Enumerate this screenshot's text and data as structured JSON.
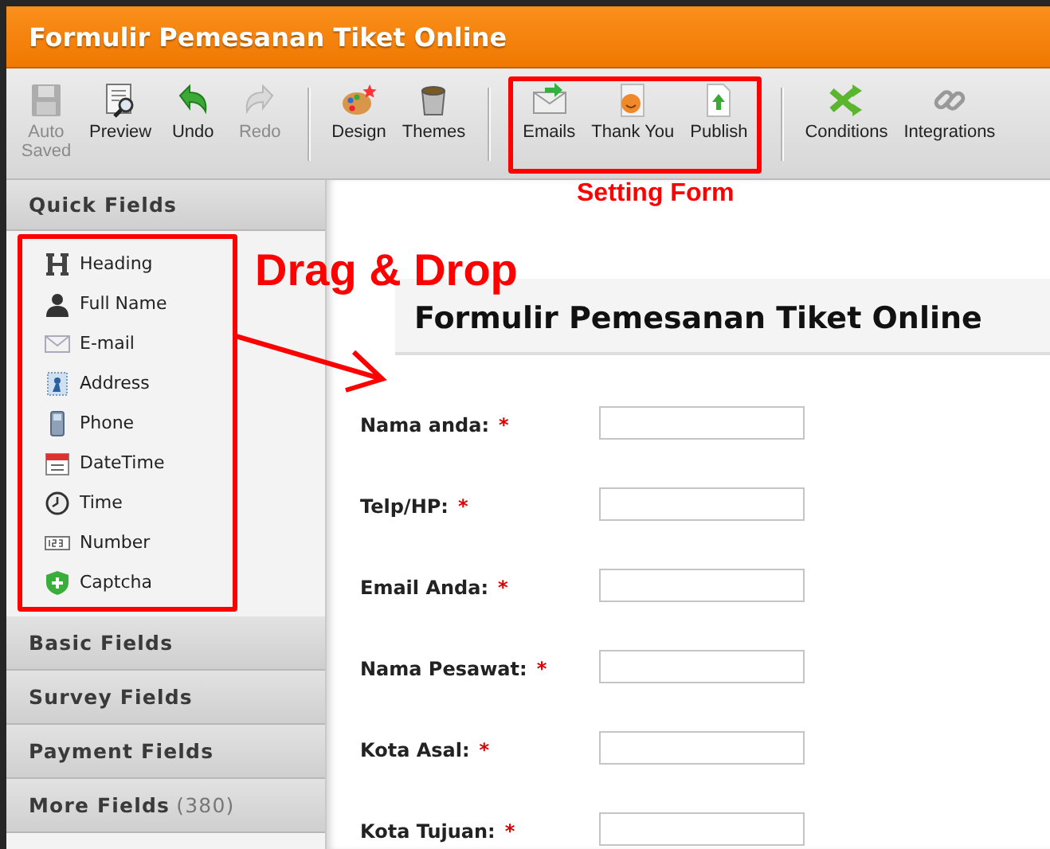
{
  "window": {
    "title": "Formulir Pemesanan Tiket Online"
  },
  "toolbar": {
    "groups": [
      {
        "buttons": [
          {
            "label": "Auto Saved",
            "disabled": true
          },
          {
            "label": "Preview",
            "disabled": false
          },
          {
            "label": "Undo",
            "disabled": false
          },
          {
            "label": "Redo",
            "disabled": true
          }
        ]
      },
      {
        "buttons": [
          {
            "label": "Design",
            "disabled": false
          },
          {
            "label": "Themes",
            "disabled": false
          }
        ]
      },
      {
        "highlighted": true,
        "buttons": [
          {
            "label": "Emails",
            "disabled": false
          },
          {
            "label": "Thank You",
            "disabled": false
          },
          {
            "label": "Publish",
            "disabled": false
          }
        ]
      },
      {
        "buttons": [
          {
            "label": "Conditions",
            "disabled": false
          },
          {
            "label": "Integrations",
            "disabled": false
          }
        ]
      }
    ]
  },
  "sidebar": {
    "sections": [
      {
        "title": "Quick Fields",
        "expanded": true,
        "highlighted": true,
        "items": [
          {
            "label": "Heading"
          },
          {
            "label": "Full Name"
          },
          {
            "label": "E-mail"
          },
          {
            "label": "Address"
          },
          {
            "label": "Phone"
          },
          {
            "label": "DateTime"
          },
          {
            "label": "Time"
          },
          {
            "label": "Number"
          },
          {
            "label": "Captcha"
          }
        ]
      },
      {
        "title": "Basic Fields"
      },
      {
        "title": "Survey Fields"
      },
      {
        "title": "Payment Fields"
      },
      {
        "title": "More Fields",
        "count": "(380)"
      }
    ]
  },
  "form": {
    "title": "Formulir Pemesanan Tiket Online",
    "fields": [
      {
        "label": "Nama anda:",
        "required_mark": "*"
      },
      {
        "label": "Telp/HP:",
        "required_mark": "*"
      },
      {
        "label": "Email Anda:",
        "required_mark": "*"
      },
      {
        "label": "Nama Pesawat:",
        "required_mark": "*"
      },
      {
        "label": "Kota Asal:",
        "required_mark": "*"
      },
      {
        "label": "Kota Tujuan:",
        "required_mark": "*"
      }
    ]
  },
  "annotations": {
    "drag_label": "Drag & Drop",
    "setting_label": "Setting Form"
  }
}
